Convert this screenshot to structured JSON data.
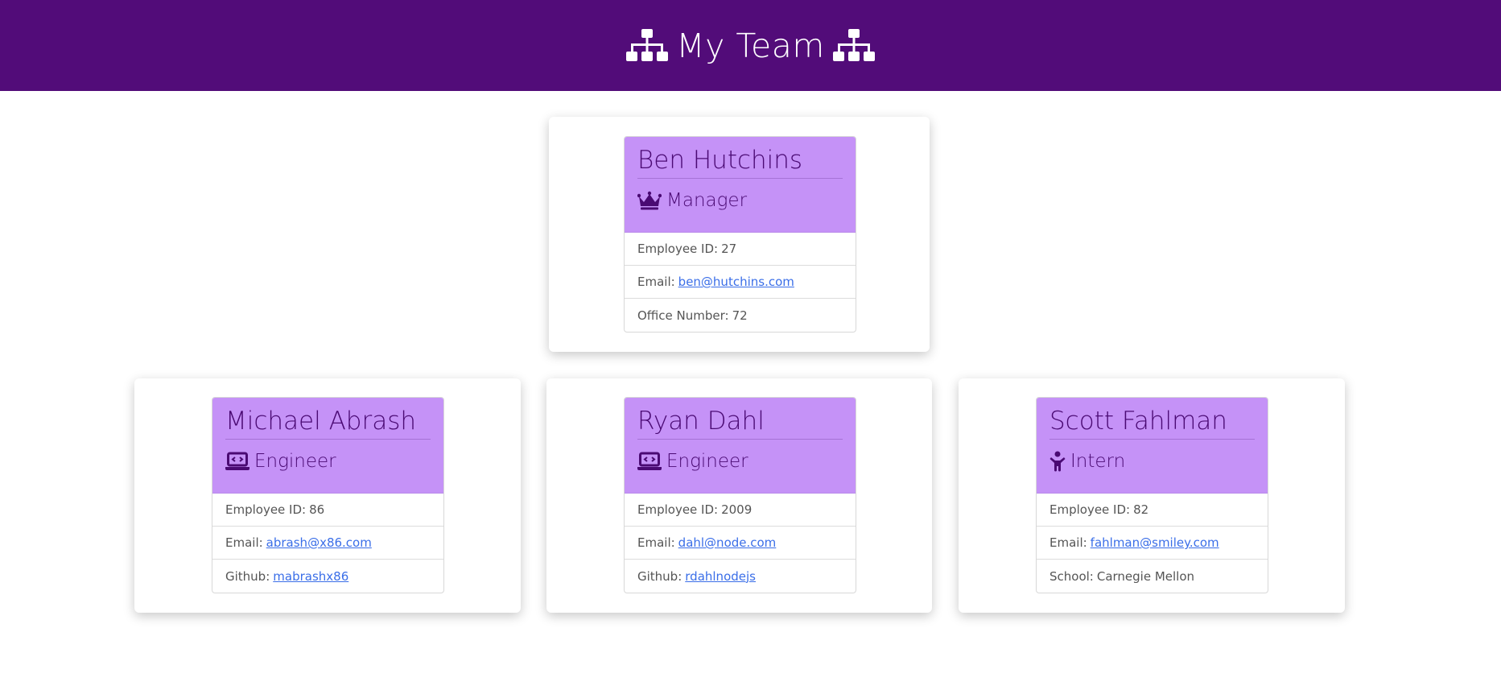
{
  "header": {
    "title": "My Team",
    "icon_left": "sitemap-icon",
    "icon_right": "sitemap-icon"
  },
  "colors": {
    "header_bg": "#520c79",
    "card_head_bg": "#c592f7",
    "card_head_text": "#4a0a73",
    "link": "#3a6ee8"
  },
  "manager": {
    "name": "Ben Hutchins",
    "role": "Manager",
    "role_icon": "crown-icon",
    "id_label": "Employee ID:",
    "id": "27",
    "email_label": "Email:",
    "email": "ben@hutchins.com",
    "extra_label": "Office Number:",
    "extra": "72"
  },
  "team": [
    {
      "name": "Michael Abrash",
      "role": "Engineer",
      "role_icon": "laptop-code-icon",
      "id_label": "Employee ID:",
      "id": "86",
      "email_label": "Email:",
      "email": "abrash@x86.com",
      "extra_label": "Github:",
      "extra": "mabrashx86"
    },
    {
      "name": "Ryan Dahl",
      "role": "Engineer",
      "role_icon": "laptop-code-icon",
      "id_label": "Employee ID:",
      "id": "2009",
      "email_label": "Email:",
      "email": "dahl@node.com",
      "extra_label": "Github:",
      "extra": "rdahlnodejs"
    },
    {
      "name": "Scott Fahlman",
      "role": "Intern",
      "role_icon": "child-icon",
      "id_label": "Employee ID:",
      "id": "82",
      "email_label": "Email:",
      "email": "fahlman@smiley.com",
      "extra_label": "School:",
      "extra": "Carnegie Mellon"
    }
  ]
}
